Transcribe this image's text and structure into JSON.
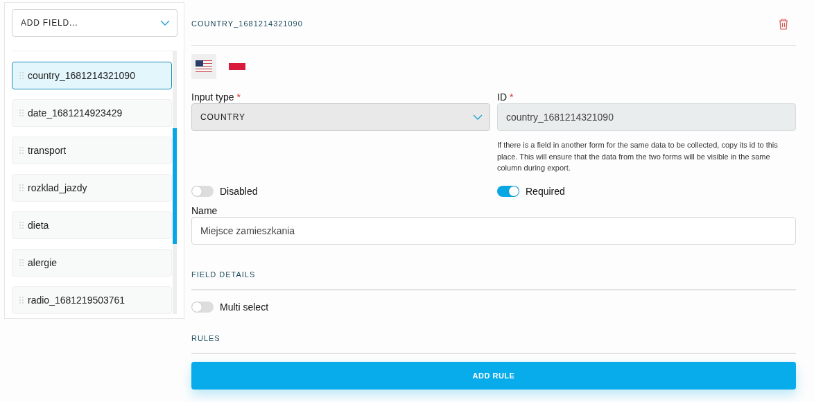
{
  "sidebar": {
    "add_field": {
      "label": "ADD FIELD..."
    },
    "items": [
      {
        "label": "country_1681214321090",
        "selected": true
      },
      {
        "label": "date_1681214923429",
        "selected": false
      },
      {
        "label": "transport",
        "selected": false
      },
      {
        "label": "rozklad_jazdy",
        "selected": false
      },
      {
        "label": "dieta",
        "selected": false
      },
      {
        "label": "alergie",
        "selected": false
      },
      {
        "label": "radio_1681219503761",
        "selected": false
      }
    ]
  },
  "editor": {
    "title": "COUNTRY_1681214321090",
    "languages": [
      {
        "kind": "us",
        "selected": true
      },
      {
        "kind": "pl",
        "selected": false
      }
    ],
    "input_type": {
      "label": "Input type",
      "required_mark": "*",
      "value": "COUNTRY"
    },
    "id": {
      "label": "ID",
      "required_mark": "*",
      "value": "country_1681214321090",
      "help": "If there is a field in another form for the same data to be collected, copy its id to this place. This will ensure that the data from the two forms will be visible in the same column during export."
    },
    "disabled": {
      "label": "Disabled",
      "on": false
    },
    "required": {
      "label": "Required",
      "on": true
    },
    "name": {
      "label": "Name",
      "value": "Miejsce zamieszkania"
    },
    "field_details": {
      "heading": "FIELD DETAILS",
      "multi_select": {
        "label": "Multi select",
        "on": false
      }
    },
    "rules": {
      "heading": "RULES",
      "button": "ADD RULE"
    }
  }
}
